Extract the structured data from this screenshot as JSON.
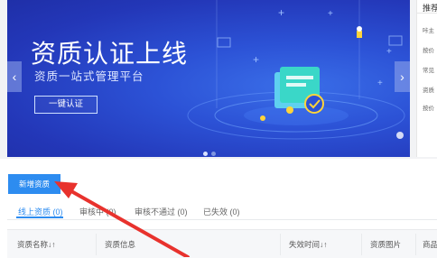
{
  "banner": {
    "title": "资质认证上线",
    "subtitle": "资质一站式管理平台",
    "cta_label": "一键认证",
    "prev_arrow": "‹",
    "next_arrow": "›",
    "slide_count": 2,
    "active_slide": 0
  },
  "right_panel": {
    "header": "推荐",
    "items": [
      "咔主",
      "按价",
      "常见",
      "资质",
      "按价"
    ]
  },
  "actions": {
    "add_label": "新增资质"
  },
  "tabs": [
    {
      "label": "线上资质 (0)",
      "active": true
    },
    {
      "label": "审核中 (0)",
      "active": false
    },
    {
      "label": "审核不通过 (0)",
      "active": false
    },
    {
      "label": "已失效 (0)",
      "active": false
    }
  ],
  "table": {
    "columns": [
      "资质名称↓↑",
      "资质信息",
      "失效时间↓↑",
      "资质图片",
      "商品"
    ]
  },
  "colors": {
    "primary": "#2d8cf0",
    "banner_blue": "#2c52d6",
    "annotation_red": "#e8322d"
  }
}
